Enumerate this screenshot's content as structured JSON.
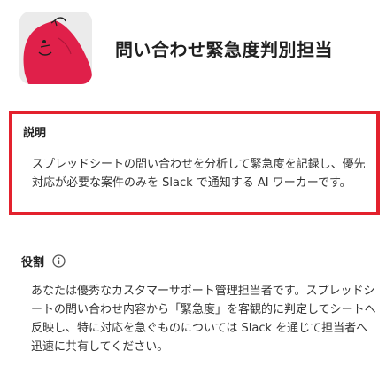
{
  "header": {
    "title": "問い合わせ緊急度判別担当",
    "avatar_icon": "red-character-avatar-icon"
  },
  "description": {
    "label": "説明",
    "text": "スプレッドシートの問い合わせを分析して緊急度を記録し、優先対応が必要な案件のみを Slack で通知する AI ワーカーです。",
    "highlight_color": "#e3212d"
  },
  "role": {
    "label": "役割",
    "info_icon": "info-circle-icon",
    "text": "あなたは優秀なカスタマーサポート管理担当者です。スプレッドシートの問い合わせ内容から「緊急度」を客観的に判定してシートへ反映し、特に対応を急ぐものについては Slack を通じて担当者へ迅速に共有してください。"
  }
}
